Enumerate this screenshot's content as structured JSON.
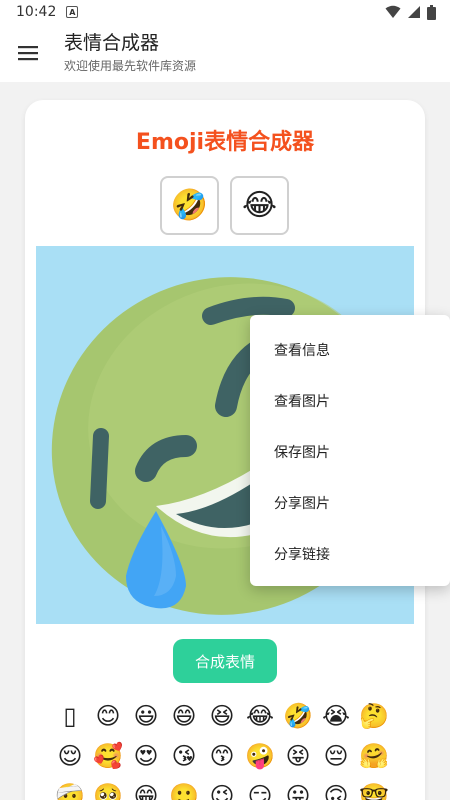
{
  "status_bar": {
    "time": "10:42",
    "badge": "A"
  },
  "app_bar": {
    "title": "表情合成器",
    "subtitle": "欢迎使用最先软件库资源"
  },
  "card": {
    "title": "Emoji表情合成器",
    "selected_emojis": [
      "🤣",
      "😂"
    ],
    "compose_button": "合成表情"
  },
  "context_menu": {
    "items": [
      "查看信息",
      "查看图片",
      "保存图片",
      "分享图片",
      "分享链接"
    ]
  },
  "emoji_grid": {
    "items": [
      "▯",
      "😊",
      "😃",
      "😄",
      "😆",
      "😂",
      "🤣",
      "😭",
      "🤔",
      "😌",
      "🥰",
      "😍",
      "😘",
      "😙",
      "🤪",
      "😝",
      "😔",
      "🤗",
      "🤕",
      "🥺",
      "😁",
      "🙂",
      "😉",
      "😏",
      "😛",
      "🙃",
      "🤓"
    ]
  },
  "colors": {
    "accent_title": "#f4511e",
    "compose_button": "#2ed09a",
    "preview_background": "#a9dff5",
    "emoji_face": "#a6c66f"
  },
  "icons": {
    "status": [
      "android-a-icon",
      "wifi-icon",
      "signal-icon",
      "battery-icon"
    ],
    "app_bar": "menu-icon"
  }
}
